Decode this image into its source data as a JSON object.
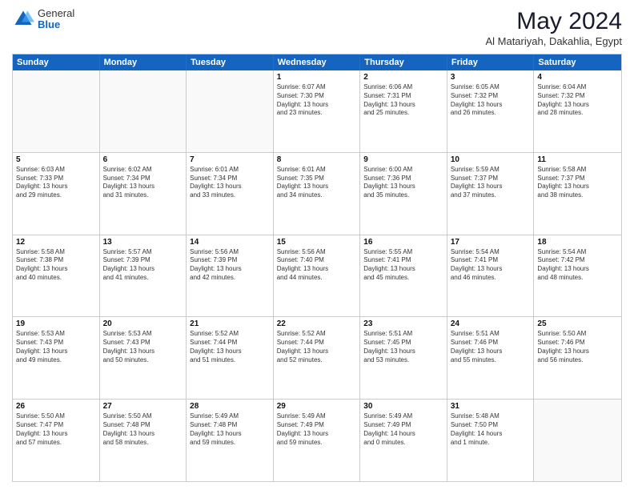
{
  "logo": {
    "general": "General",
    "blue": "Blue"
  },
  "title": "May 2024",
  "subtitle": "Al Matariyah, Dakahlia, Egypt",
  "headers": [
    "Sunday",
    "Monday",
    "Tuesday",
    "Wednesday",
    "Thursday",
    "Friday",
    "Saturday"
  ],
  "weeks": [
    [
      {
        "day": "",
        "info": ""
      },
      {
        "day": "",
        "info": ""
      },
      {
        "day": "",
        "info": ""
      },
      {
        "day": "1",
        "info": "Sunrise: 6:07 AM\nSunset: 7:30 PM\nDaylight: 13 hours\nand 23 minutes."
      },
      {
        "day": "2",
        "info": "Sunrise: 6:06 AM\nSunset: 7:31 PM\nDaylight: 13 hours\nand 25 minutes."
      },
      {
        "day": "3",
        "info": "Sunrise: 6:05 AM\nSunset: 7:32 PM\nDaylight: 13 hours\nand 26 minutes."
      },
      {
        "day": "4",
        "info": "Sunrise: 6:04 AM\nSunset: 7:32 PM\nDaylight: 13 hours\nand 28 minutes."
      }
    ],
    [
      {
        "day": "5",
        "info": "Sunrise: 6:03 AM\nSunset: 7:33 PM\nDaylight: 13 hours\nand 29 minutes."
      },
      {
        "day": "6",
        "info": "Sunrise: 6:02 AM\nSunset: 7:34 PM\nDaylight: 13 hours\nand 31 minutes."
      },
      {
        "day": "7",
        "info": "Sunrise: 6:01 AM\nSunset: 7:34 PM\nDaylight: 13 hours\nand 33 minutes."
      },
      {
        "day": "8",
        "info": "Sunrise: 6:01 AM\nSunset: 7:35 PM\nDaylight: 13 hours\nand 34 minutes."
      },
      {
        "day": "9",
        "info": "Sunrise: 6:00 AM\nSunset: 7:36 PM\nDaylight: 13 hours\nand 35 minutes."
      },
      {
        "day": "10",
        "info": "Sunrise: 5:59 AM\nSunset: 7:37 PM\nDaylight: 13 hours\nand 37 minutes."
      },
      {
        "day": "11",
        "info": "Sunrise: 5:58 AM\nSunset: 7:37 PM\nDaylight: 13 hours\nand 38 minutes."
      }
    ],
    [
      {
        "day": "12",
        "info": "Sunrise: 5:58 AM\nSunset: 7:38 PM\nDaylight: 13 hours\nand 40 minutes."
      },
      {
        "day": "13",
        "info": "Sunrise: 5:57 AM\nSunset: 7:39 PM\nDaylight: 13 hours\nand 41 minutes."
      },
      {
        "day": "14",
        "info": "Sunrise: 5:56 AM\nSunset: 7:39 PM\nDaylight: 13 hours\nand 42 minutes."
      },
      {
        "day": "15",
        "info": "Sunrise: 5:56 AM\nSunset: 7:40 PM\nDaylight: 13 hours\nand 44 minutes."
      },
      {
        "day": "16",
        "info": "Sunrise: 5:55 AM\nSunset: 7:41 PM\nDaylight: 13 hours\nand 45 minutes."
      },
      {
        "day": "17",
        "info": "Sunrise: 5:54 AM\nSunset: 7:41 PM\nDaylight: 13 hours\nand 46 minutes."
      },
      {
        "day": "18",
        "info": "Sunrise: 5:54 AM\nSunset: 7:42 PM\nDaylight: 13 hours\nand 48 minutes."
      }
    ],
    [
      {
        "day": "19",
        "info": "Sunrise: 5:53 AM\nSunset: 7:43 PM\nDaylight: 13 hours\nand 49 minutes."
      },
      {
        "day": "20",
        "info": "Sunrise: 5:53 AM\nSunset: 7:43 PM\nDaylight: 13 hours\nand 50 minutes."
      },
      {
        "day": "21",
        "info": "Sunrise: 5:52 AM\nSunset: 7:44 PM\nDaylight: 13 hours\nand 51 minutes."
      },
      {
        "day": "22",
        "info": "Sunrise: 5:52 AM\nSunset: 7:44 PM\nDaylight: 13 hours\nand 52 minutes."
      },
      {
        "day": "23",
        "info": "Sunrise: 5:51 AM\nSunset: 7:45 PM\nDaylight: 13 hours\nand 53 minutes."
      },
      {
        "day": "24",
        "info": "Sunrise: 5:51 AM\nSunset: 7:46 PM\nDaylight: 13 hours\nand 55 minutes."
      },
      {
        "day": "25",
        "info": "Sunrise: 5:50 AM\nSunset: 7:46 PM\nDaylight: 13 hours\nand 56 minutes."
      }
    ],
    [
      {
        "day": "26",
        "info": "Sunrise: 5:50 AM\nSunset: 7:47 PM\nDaylight: 13 hours\nand 57 minutes."
      },
      {
        "day": "27",
        "info": "Sunrise: 5:50 AM\nSunset: 7:48 PM\nDaylight: 13 hours\nand 58 minutes."
      },
      {
        "day": "28",
        "info": "Sunrise: 5:49 AM\nSunset: 7:48 PM\nDaylight: 13 hours\nand 59 minutes."
      },
      {
        "day": "29",
        "info": "Sunrise: 5:49 AM\nSunset: 7:49 PM\nDaylight: 13 hours\nand 59 minutes."
      },
      {
        "day": "30",
        "info": "Sunrise: 5:49 AM\nSunset: 7:49 PM\nDaylight: 14 hours\nand 0 minutes."
      },
      {
        "day": "31",
        "info": "Sunrise: 5:48 AM\nSunset: 7:50 PM\nDaylight: 14 hours\nand 1 minute."
      },
      {
        "day": "",
        "info": ""
      }
    ]
  ]
}
